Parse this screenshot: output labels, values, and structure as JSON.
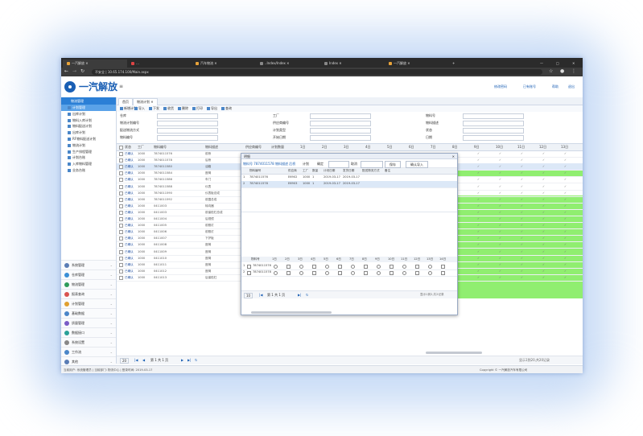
{
  "browser": {
    "tabs": [
      "一汽解放  ✕",
      "…",
      "汽车物流  ✕",
      "..Index/Index  ✕",
      "Index  ✕",
      "一汽解放  ✕"
    ],
    "address": "不安全 | 10.65.174.100/Main.aspx"
  },
  "app": {
    "brand": "一汽解放",
    "header_links": [
      "修改密码",
      "已有账号",
      "帮助",
      "退出"
    ]
  },
  "sidebar": {
    "title": "物流管理",
    "items": [
      "计划管理",
      "出库计划",
      "物料入库计划",
      "物料配送计划",
      "出库计划",
      "RF物料配送计划",
      "物流计划",
      "生产排程管理",
      "计划台账",
      "入库物料管理",
      "业务台账"
    ],
    "selected_index": 0,
    "groups": [
      "系统管理",
      "仓库管理",
      "物流管理",
      "报表查询",
      "计划管理",
      "基础数据",
      "质量管理",
      "数据接口",
      "系统设置",
      "工作流",
      "其他"
    ]
  },
  "main": {
    "tabs": [
      "首页",
      "物流计划 ✕"
    ],
    "toolbar": [
      "新增计划",
      "导入",
      "下发",
      "收货",
      "删除",
      "打印",
      "导出",
      "查询"
    ],
    "filters": [
      {
        "label": "仓库",
        "value": ""
      },
      {
        "label": "物流计划编号",
        "value": ""
      },
      {
        "label": "配送物流方式",
        "value": ""
      },
      {
        "label": "物料编号",
        "value": ""
      },
      {
        "label": "工厂",
        "value": ""
      },
      {
        "label": "供应商编号",
        "value": ""
      },
      {
        "label": "计划类型",
        "value": ""
      },
      {
        "label": "开始日期",
        "value": ""
      },
      {
        "label": "物料号",
        "value": ""
      },
      {
        "label": "物料描述",
        "value": ""
      },
      {
        "label": "状态",
        "value": ""
      },
      {
        "label": "日期",
        "value": ""
      }
    ],
    "grid_headers": [
      "状态",
      "工厂",
      "物料编号",
      "物料描述",
      "供应商编号",
      "计划数量",
      "1日",
      "2日",
      "3日",
      "4日",
      "5日",
      "6日",
      "7日",
      "8日",
      "9日",
      "10日",
      "11日",
      "12日",
      "13日"
    ],
    "rows": [
      [
        "已确认",
        "1000",
        "7874011576",
        "前桥"
      ],
      [
        "已确认",
        "1000",
        "7874011578",
        "后桥"
      ],
      [
        "已确认",
        "1000",
        "7874011580",
        "油箱"
      ],
      [
        "已确认",
        "1000",
        "7874011584",
        "座椅"
      ],
      [
        "已确认",
        "1000",
        "7874011586",
        "车门"
      ],
      [
        "已确认",
        "1000",
        "7874011588",
        "仪表"
      ],
      [
        "已确认",
        "1000",
        "7874011590",
        "仪表板总成"
      ],
      [
        "已确认",
        "1000",
        "7874011592",
        "前围总成"
      ],
      [
        "已确认",
        "1000",
        "0411003",
        "转向器"
      ],
      [
        "已确认",
        "1000",
        "0411003",
        "前保险杠总成"
      ],
      [
        "已确认",
        "1000",
        "0411004",
        "后视镜"
      ],
      [
        "已确认",
        "1000",
        "0411005",
        "前照灯"
      ],
      [
        "已确认",
        "1000",
        "0411006",
        "前照灯"
      ],
      [
        "已确认",
        "1000",
        "0411007",
        "下护板"
      ],
      [
        "已确认",
        "1000",
        "0411008",
        "座椅"
      ],
      [
        "已确认",
        "1000",
        "0411009",
        "座椅"
      ],
      [
        "已确认",
        "1000",
        "0411010",
        "座椅"
      ],
      [
        "已确认",
        "1000",
        "0411011",
        "座椅"
      ],
      [
        "已确认",
        "1000",
        "0411012",
        "座椅"
      ],
      [
        "已确认",
        "1000",
        "0411013",
        "后保险杠"
      ]
    ],
    "pager": {
      "page_size": "20",
      "page_label": "第 1 共 1 页",
      "summary": "显示1到20,共20记录"
    }
  },
  "dialog": {
    "title": "明细",
    "toolbar": [
      "物料号 7874011578",
      "物料描述 后桥",
      "计划",
      "确定",
      "取消",
      "保存",
      "确认导入"
    ],
    "headers": [
      "物料编号",
      "供应商",
      "工厂",
      "数量",
      "计划日期",
      "发货日期",
      "配送物流方式",
      "备注"
    ],
    "rows": [
      [
        "7874011576",
        "E6902",
        "1000",
        "1",
        "2019-03-17",
        "2019-03-17",
        "",
        ""
      ],
      [
        "7874011578",
        "E6903",
        "1000",
        "1",
        "2019-03-17",
        "2019-03-17",
        "",
        ""
      ]
    ],
    "pager": {
      "page_size": "10",
      "page_label": "第 1 共 1 页",
      "summary": "显示1到2,共2记录"
    },
    "lower_headers": [
      "物料号",
      "1日",
      "2日",
      "3日",
      "4日",
      "5日",
      "6日",
      "7日",
      "8日",
      "9日",
      "10日",
      "11日",
      "12日",
      "13日",
      "14日"
    ],
    "lower_rows": [
      "7874011576",
      "7874011578"
    ]
  },
  "status_bar": {
    "left": "当前用户: 系统管理员 | 当前部门: 物流中心 | 登录时间: 2019-03-17",
    "right": "Copyright © 一汽解放汽车有限公司"
  }
}
